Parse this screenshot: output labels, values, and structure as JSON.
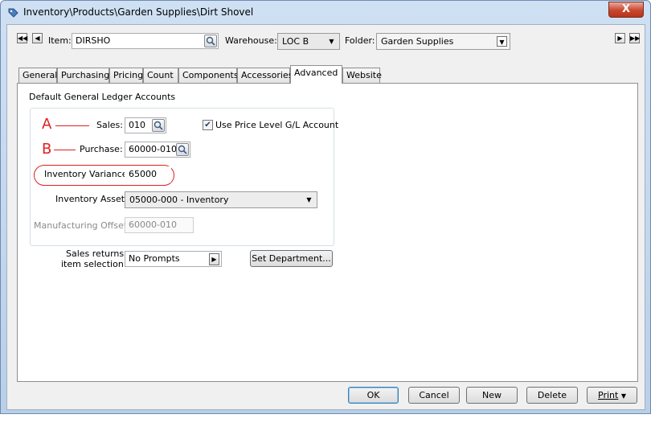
{
  "window": {
    "title": "Inventory\\Products\\Garden Supplies\\Dirt Shovel",
    "close_label": "X"
  },
  "header": {
    "item_label": "Item:",
    "item_value": "DIRSHO",
    "warehouse_label": "Warehouse:",
    "warehouse_value": "LOC B",
    "folder_label": "Folder:",
    "folder_value": "Garden Supplies"
  },
  "tabs": [
    {
      "label": "General"
    },
    {
      "label": "Purchasing"
    },
    {
      "label": "Pricing"
    },
    {
      "label": "Count"
    },
    {
      "label": "Components"
    },
    {
      "label": "Accessories"
    },
    {
      "label": "Advanced",
      "active": true
    },
    {
      "label": "Website"
    }
  ],
  "advanced": {
    "section_title": "Default General Ledger Accounts",
    "sales_label": "Sales:",
    "sales_value": "010",
    "use_price_level_label": "Use Price Level G/L Account",
    "use_price_level_checked": true,
    "purchase_label": "Purchase:",
    "purchase_value": "60000-010",
    "inventory_variance_label": "Inventory Variance:",
    "inventory_variance_value": "65000",
    "inventory_asset_label": "Inventory Asset:",
    "inventory_asset_value": "05000-000 - Inventory",
    "manufacturing_offset_label": "Manufacturing Offset:",
    "manufacturing_offset_value": "60000-010",
    "sales_returns_label_1": "Sales returns",
    "sales_returns_label_2": "item selection:",
    "sales_returns_value": "No Prompts",
    "set_department_label": "Set Department..."
  },
  "annotations": {
    "a": "A",
    "b": "B",
    "color": "#e02020"
  },
  "footer": {
    "ok": "OK",
    "cancel": "Cancel",
    "new": "New",
    "delete": "Delete",
    "print": "Print"
  }
}
